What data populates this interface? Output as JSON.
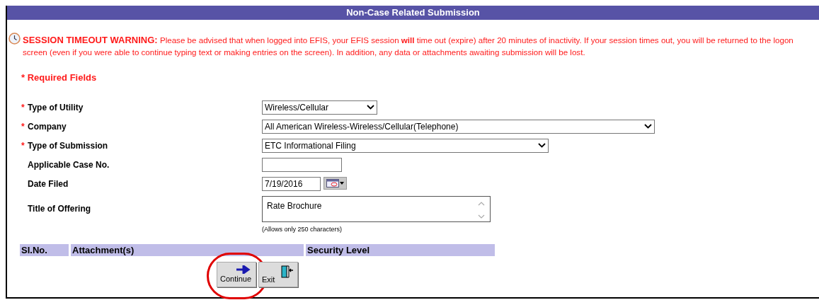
{
  "title": "Non-Case Related Submission",
  "warning": {
    "heading": "SESSION TIMEOUT WARNING:",
    "text": "Please be advised that when logged into EFIS, your EFIS session **will** time out (expire) after 20 minutes of inactivity. If your session times out, you will be returned to the logon screen (even if you were able to continue typing text or making entries on the screen). In addition, any data or attachments awaiting submission will be lost."
  },
  "required_note": {
    "mark": "*",
    "text": "Required Fields"
  },
  "fields": [
    {
      "kind": "select",
      "label": "Type of Utility",
      "required": true,
      "value": "Wireless/Cellular"
    },
    {
      "kind": "select",
      "label": "Company",
      "required": true,
      "value": "All American Wireless-Wireless/Cellular(Telephone)"
    },
    {
      "kind": "select",
      "label": "Type of Submission",
      "required": true,
      "value": "ETC Informational Filing"
    },
    {
      "kind": "text",
      "label": "Applicable Case No.",
      "required": false
    },
    {
      "kind": "date",
      "label": "Date Filed",
      "required": false,
      "value": "7/19/2016"
    },
    {
      "kind": "textarea",
      "label": "Title of Offering",
      "required": false,
      "value": "Rate Brochure",
      "note": "(Allows only 250 characters)"
    }
  ],
  "attachments_table": {
    "columns": [
      "SI.No.",
      "Attachment(s)",
      "Security Level"
    ]
  },
  "buttons": [
    {
      "kind": "continue",
      "label": "Continue",
      "highlighted": true
    },
    {
      "kind": "exit",
      "label": "Exit",
      "highlighted": false
    }
  ]
}
